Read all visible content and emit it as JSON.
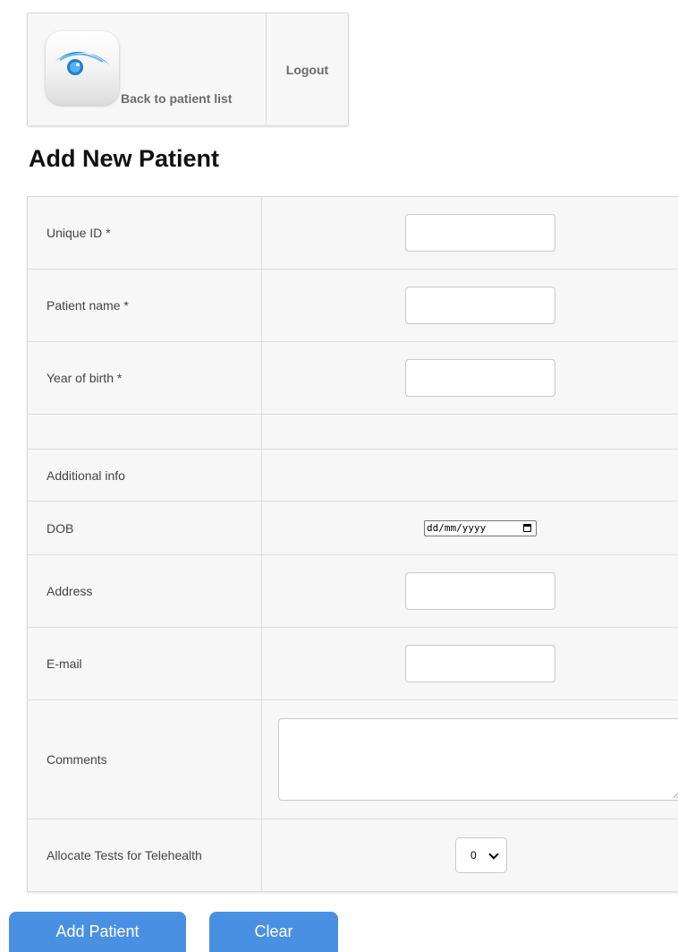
{
  "header": {
    "back_label": "Back to patient list",
    "logout_label": "Logout",
    "app_icon": "eye-icon"
  },
  "page_title": "Add New Patient",
  "form": {
    "unique_id": {
      "label": "Unique ID *",
      "value": ""
    },
    "patient_name": {
      "label": "Patient name *",
      "value": ""
    },
    "year_of_birth": {
      "label": "Year of birth *",
      "value": ""
    },
    "additional_info": {
      "label": "Additional info"
    },
    "dob": {
      "label": "DOB",
      "placeholder": "dd/mm/yyyy"
    },
    "address": {
      "label": "Address",
      "value": ""
    },
    "email": {
      "label": "E-mail",
      "value": ""
    },
    "comments": {
      "label": "Comments",
      "value": ""
    },
    "telehealth": {
      "label": "Allocate Tests for Telehealth",
      "selected": "0"
    }
  },
  "buttons": {
    "add_patient": "Add Patient",
    "clear": "Clear"
  },
  "colors": {
    "primary_button": "#4a90e2",
    "icon_blue": "#1a7fd0"
  }
}
